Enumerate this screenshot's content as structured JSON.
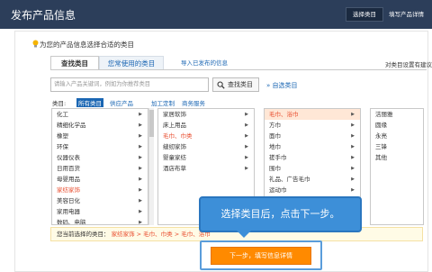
{
  "header": {
    "title": "发布产品信息",
    "select_category": "选择类目",
    "fill_details": "填写产品详情"
  },
  "hint": "为您的产品信息选择合适的类目",
  "tabs": [
    "查找类目",
    "您常使用的类目",
    "导入已发布的信息"
  ],
  "right_link": "对类目设置有建议？",
  "search": {
    "placeholder": "请输入产品关键词，例如为你推荐类目",
    "button": "查找类目"
  },
  "select_label": "自选类目",
  "filters": {
    "label": "类目:",
    "items": [
      "所有类目",
      "供应产品",
      "加工定制",
      "商务服务"
    ]
  },
  "columns": [
    {
      "items": [
        "化工",
        "精细化学品",
        "橡塑",
        "环保",
        "仪器仪表",
        "日用百货",
        "母婴用品",
        "家纺家饰",
        "美容日化",
        "家用电器",
        "数码、电脑"
      ],
      "selected": "家纺家饰"
    },
    {
      "items": [
        "家居软饰",
        "床上用品",
        "毛巾、巾类",
        "缝纫家饰",
        "婴童家纺",
        "酒店布草"
      ],
      "selected": "毛巾、巾类"
    },
    {
      "items": [
        "毛巾、浴巾",
        "方巾",
        "面巾",
        "地巾",
        "搓手巾",
        "围巾",
        "礼品、广告毛巾",
        "运动巾",
        "浴巾"
      ],
      "selected": "毛巾、浴巾"
    },
    {
      "items": [
        "洁丽雅",
        "圆缘",
        "永亮",
        "三锋",
        "其他"
      ],
      "selected": ""
    }
  ],
  "selection": {
    "label": "您当前选择的类目：",
    "path": "家纺家饰 > 毛巾、巾类 > 毛巾、浴巾"
  },
  "tooltip": "选择类目后，点击下一步。",
  "next_button": "下一步，填写信息详情"
}
